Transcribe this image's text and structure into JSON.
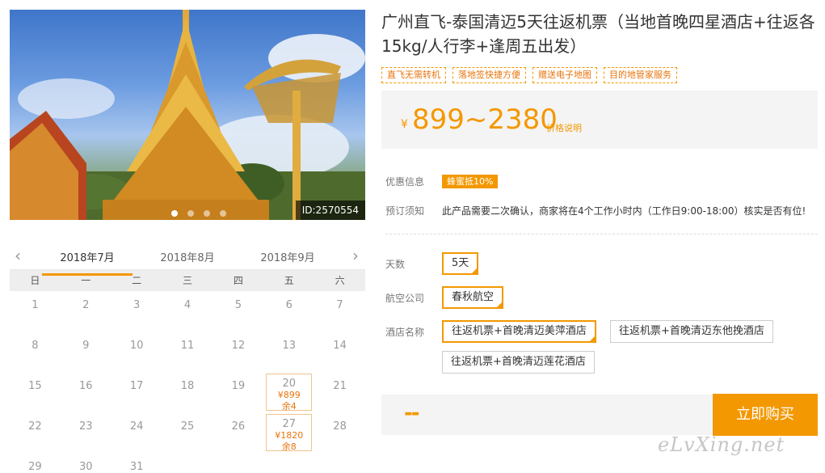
{
  "hero": {
    "id_label": "ID:2570554",
    "dots": 4,
    "active_dot": 1
  },
  "product": {
    "title": "广州直飞-泰国清迈5天往返机票（当地首晚四星酒店+往返各15kg/人行李+逢周五出发）",
    "tags": [
      "直飞无需转机",
      "落地签快捷方便",
      "赠送电子地图",
      "目的地管家服务"
    ],
    "currency": "¥",
    "price_range": "899~2380",
    "price_note": "价格说明"
  },
  "info": {
    "promo_label": "优惠信息",
    "promo_badge": "蜂蜜抵10%",
    "notice_label": "预订须知",
    "notice_text": "此产品需要二次确认，商家将在4个工作小时内（工作日9:00-18:00）核实是否有位!"
  },
  "options": {
    "days_label": "天数",
    "days": [
      "5天"
    ],
    "airline_label": "航空公司",
    "airlines": [
      "春秋航空"
    ],
    "hotel_label": "酒店名称",
    "hotels": [
      "往返机票+首晚清迈美萍酒店",
      "往返机票+首晚清迈东他挽酒店",
      "往返机票+首晚清迈莲花酒店"
    ],
    "selected_hotel": 0
  },
  "calendar": {
    "months": [
      "2018年7月",
      "2018年8月",
      "2018年9月"
    ],
    "active_month": 0,
    "weekdays": [
      "日",
      "一",
      "二",
      "三",
      "四",
      "五",
      "六"
    ],
    "days": [
      {
        "d": "1"
      },
      {
        "d": "2"
      },
      {
        "d": "3"
      },
      {
        "d": "4"
      },
      {
        "d": "5"
      },
      {
        "d": "6"
      },
      {
        "d": "7"
      },
      {
        "d": "8"
      },
      {
        "d": "9"
      },
      {
        "d": "10"
      },
      {
        "d": "11"
      },
      {
        "d": "12"
      },
      {
        "d": "13"
      },
      {
        "d": "14"
      },
      {
        "d": "15"
      },
      {
        "d": "16"
      },
      {
        "d": "17"
      },
      {
        "d": "18"
      },
      {
        "d": "19"
      },
      {
        "d": "20",
        "price": "¥899",
        "left": "余4"
      },
      {
        "d": "21"
      },
      {
        "d": "22"
      },
      {
        "d": "23"
      },
      {
        "d": "24"
      },
      {
        "d": "25"
      },
      {
        "d": "26"
      },
      {
        "d": "27",
        "price": "¥1820",
        "left": "余8"
      },
      {
        "d": "28"
      },
      {
        "d": "29"
      },
      {
        "d": "30"
      },
      {
        "d": "31"
      }
    ]
  },
  "buy": {
    "selected_price": "--",
    "button_label": "立即购买"
  },
  "watermark": "eLvXing.net"
}
